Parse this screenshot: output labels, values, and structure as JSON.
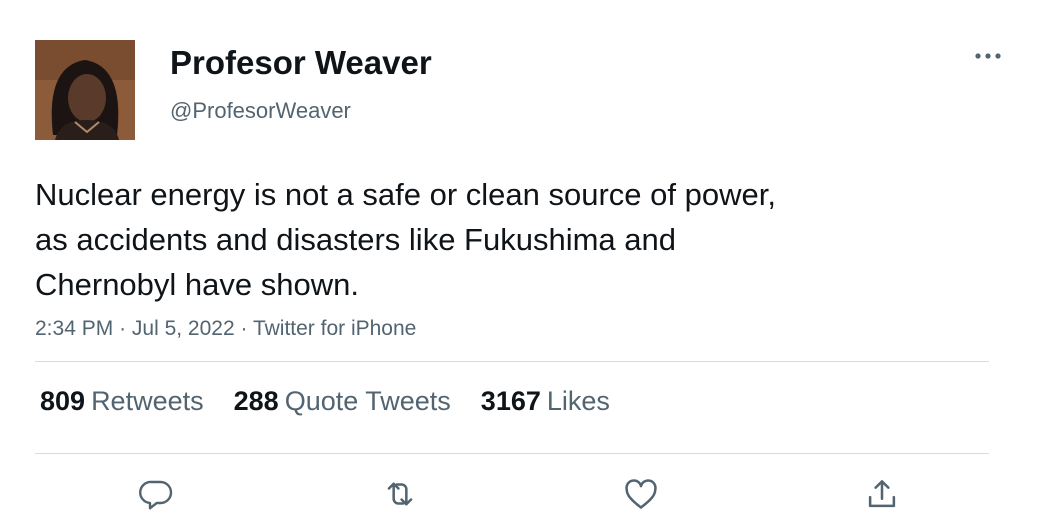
{
  "user": {
    "display_name": "Profesor Weaver",
    "handle": "@ProfesorWeaver"
  },
  "tweet": {
    "lines": [
      "Nuclear energy is not a safe or clean source of power,",
      "as accidents and disasters like Fukushima and",
      "Chernobyl have shown."
    ],
    "time": "2:34 PM",
    "date": "Jul 5, 2022",
    "source": "Twitter for iPhone",
    "separator": "·"
  },
  "stats": {
    "retweets_count": "809",
    "retweets_label": "Retweets",
    "quote_count": "288",
    "quote_label": "Quote Tweets",
    "likes_count": "3167",
    "likes_label": "Likes"
  },
  "icons": {
    "more": "more-horizontal-icon",
    "reply": "reply-icon",
    "retweet": "retweet-icon",
    "like": "heart-icon",
    "share": "share-icon"
  },
  "colors": {
    "text": "#0f1419",
    "secondary": "#536471",
    "divider": "#d7dbdf"
  }
}
